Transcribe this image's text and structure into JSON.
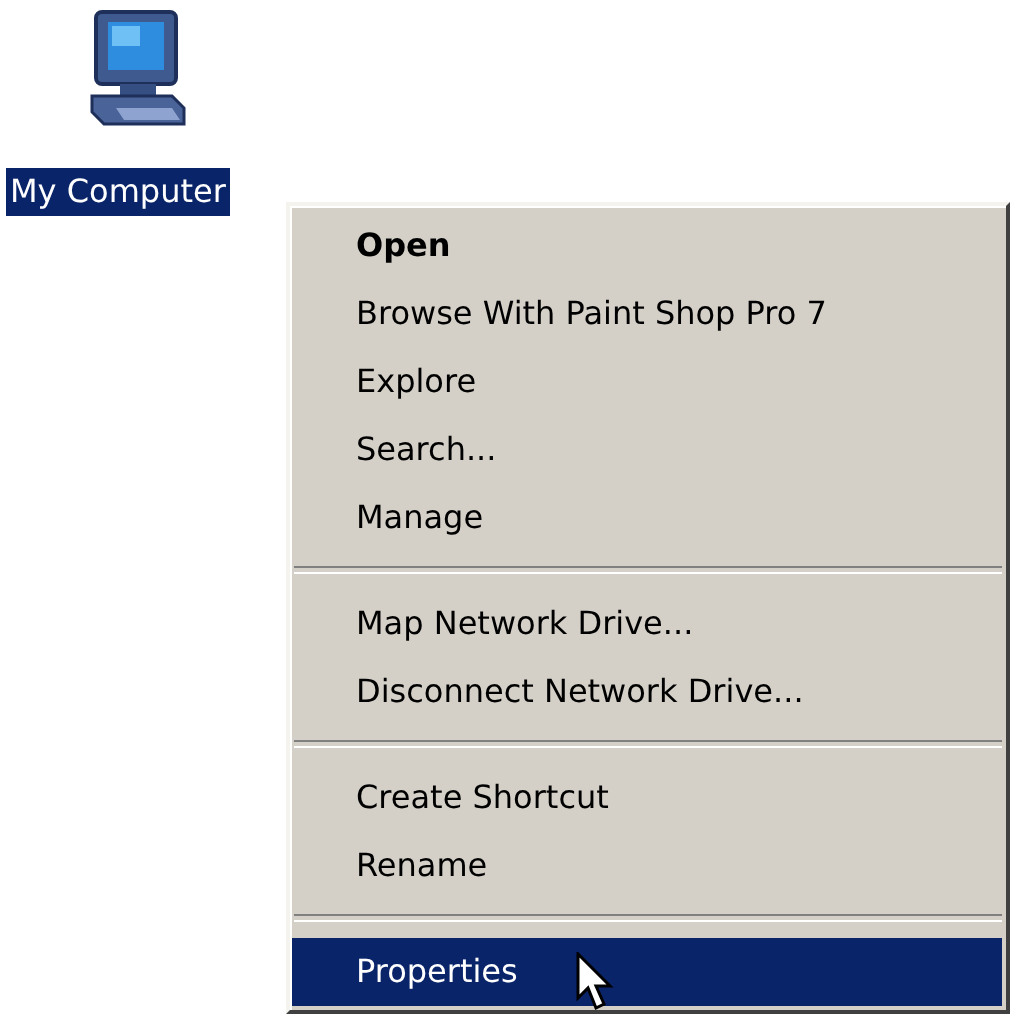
{
  "desktop_icon": {
    "label": "My Computer",
    "selected": true
  },
  "context_menu": {
    "items": [
      {
        "kind": "item",
        "label": "Open",
        "default": true,
        "selected": false
      },
      {
        "kind": "item",
        "label": "Browse With Paint Shop Pro 7",
        "default": false,
        "selected": false
      },
      {
        "kind": "item",
        "label": "Explore",
        "default": false,
        "selected": false
      },
      {
        "kind": "item",
        "label": "Search...",
        "default": false,
        "selected": false
      },
      {
        "kind": "item",
        "label": "Manage",
        "default": false,
        "selected": false
      },
      {
        "kind": "separator"
      },
      {
        "kind": "item",
        "label": "Map Network Drive...",
        "default": false,
        "selected": false
      },
      {
        "kind": "item",
        "label": "Disconnect Network Drive...",
        "default": false,
        "selected": false
      },
      {
        "kind": "separator"
      },
      {
        "kind": "item",
        "label": "Create Shortcut",
        "default": false,
        "selected": false
      },
      {
        "kind": "item",
        "label": "Rename",
        "default": false,
        "selected": false
      },
      {
        "kind": "separator"
      },
      {
        "kind": "item",
        "label": "Properties",
        "default": false,
        "selected": true
      }
    ]
  }
}
